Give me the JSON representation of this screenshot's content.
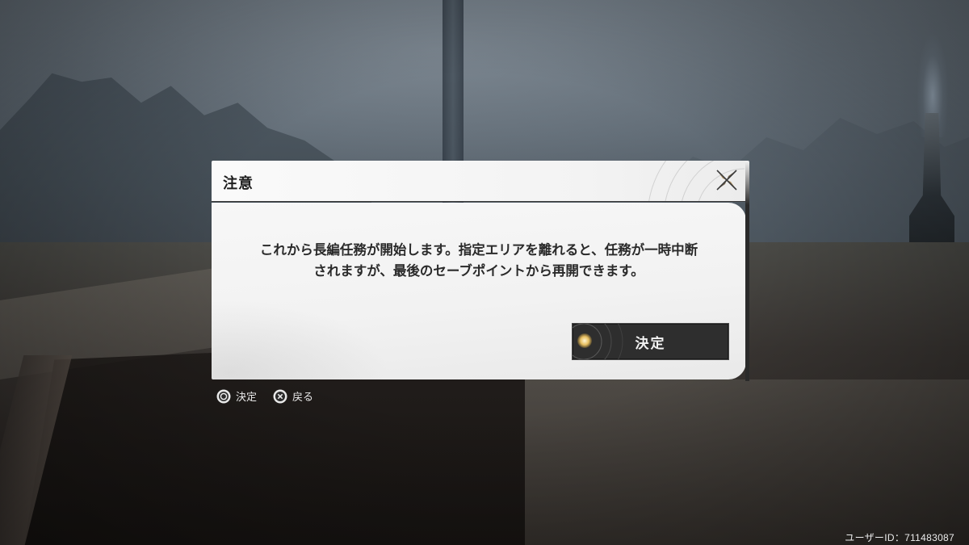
{
  "dialog": {
    "title": "注意",
    "message_lines": [
      "これから長編任務が開始します。指定エリアを離れると、任務が一時中断",
      "されますが、最後のセーブポイントから再開できます。"
    ],
    "confirm_label": "決定",
    "close_icon": "close-x-icon"
  },
  "hints": [
    {
      "icon": "circle-button-icon",
      "label": "決定"
    },
    {
      "icon": "cross-button-icon",
      "label": "戻る"
    }
  ],
  "footer": {
    "user_id": "ユーザーID：711483087"
  },
  "colors": {
    "accent_gold": "#b89a6a",
    "dialog_bg": "#f3f3f3",
    "button_bg": "#2e2e2e"
  }
}
